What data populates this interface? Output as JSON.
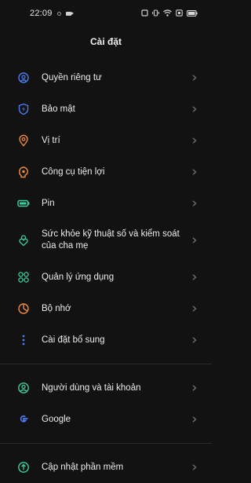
{
  "status_bar": {
    "time": "22:09"
  },
  "header": {
    "title": "Cài đặt"
  },
  "settings": {
    "items": [
      {
        "label": "Quyền riêng tư",
        "icon": "privacy-icon",
        "color": "#4a7cf0"
      },
      {
        "label": "Bảo mật",
        "icon": "security-shield-icon",
        "color": "#4a7cf0"
      },
      {
        "label": "Vị trí",
        "icon": "location-pin-icon",
        "color": "#f08a3c"
      },
      {
        "label": "Công cụ tiện lợi",
        "icon": "convenience-tools-icon",
        "color": "#f08a3c"
      },
      {
        "label": "Pin",
        "icon": "battery-icon",
        "color": "#3ecf9a"
      },
      {
        "label": "Sức khỏe kỹ thuật số và kiểm soát của cha mẹ",
        "icon": "digital-wellbeing-icon",
        "color": "#3ecf9a"
      },
      {
        "label": "Quản lý ứng dụng",
        "icon": "app-management-icon",
        "color": "#3ecf9a"
      },
      {
        "label": "Bộ nhớ",
        "icon": "storage-pie-icon",
        "color": "#f08a3c"
      },
      {
        "label": "Cài đặt bổ sung",
        "icon": "additional-settings-icon",
        "color": "#4a7cf0"
      },
      {
        "label": "Người dùng và tài khoản",
        "icon": "users-accounts-icon",
        "color": "#3ecf9a"
      },
      {
        "label": "Google",
        "icon": "google-icon",
        "color": "#4a7cf0"
      },
      {
        "label": "Cập nhật phần mềm",
        "icon": "software-update-icon",
        "color": "#3ecf9a"
      }
    ]
  }
}
